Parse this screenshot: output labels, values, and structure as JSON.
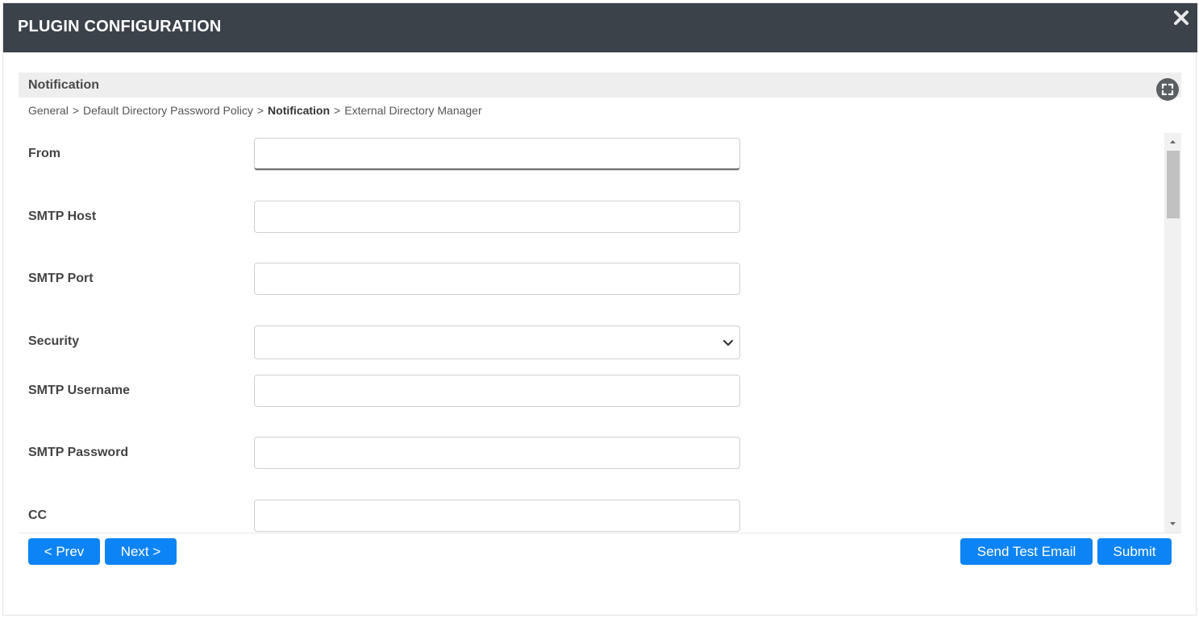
{
  "header": {
    "title": "PLUGIN CONFIGURATION",
    "close_icon": "close-icon"
  },
  "section": {
    "title": "Notification",
    "expand_icon": "expand-icon"
  },
  "breadcrumb": {
    "items": [
      "General",
      "Default Directory Password Policy",
      "Notification",
      "External Directory Manager"
    ],
    "separator": ">",
    "current": "Notification"
  },
  "form": {
    "fields": [
      {
        "label": "From",
        "value": "",
        "type": "text"
      },
      {
        "label": "SMTP Host",
        "value": "",
        "type": "text"
      },
      {
        "label": "SMTP Port",
        "value": "",
        "type": "text"
      },
      {
        "label": "Security",
        "value": "",
        "type": "select"
      },
      {
        "label": "SMTP Username",
        "value": "",
        "type": "text"
      },
      {
        "label": "SMTP Password",
        "value": "",
        "type": "password"
      },
      {
        "label": "CC",
        "value": "",
        "type": "text"
      }
    ]
  },
  "footer": {
    "prev_label": "< Prev",
    "next_label": "Next >",
    "send_test_label": "Send Test Email",
    "submit_label": "Submit"
  },
  "colors": {
    "header_bg": "#3b424a",
    "primary_button": "#0d84f5",
    "section_bg": "#eeeeee"
  }
}
